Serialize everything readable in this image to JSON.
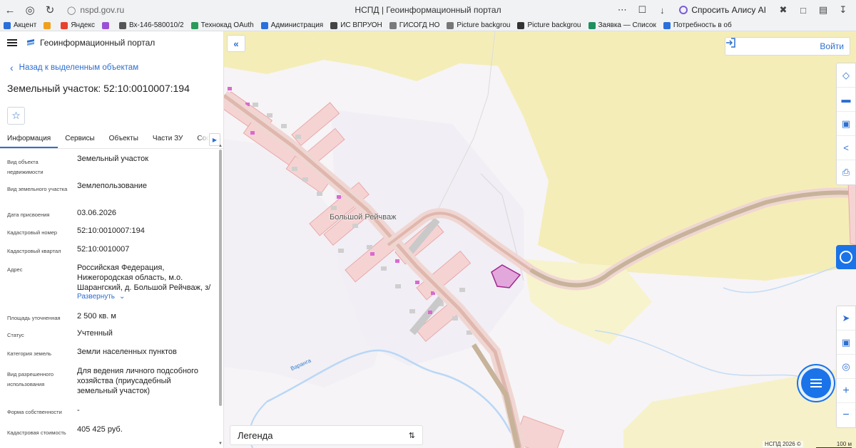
{
  "browser": {
    "url": "nspd.gov.ru",
    "tab_title": "НСПД | Геоинформационный портал",
    "ask_alice": "Спросить Алису AI",
    "bookmarks": [
      {
        "label": "Акцент",
        "color": "#2a6fdb"
      },
      {
        "label": "",
        "color": "#f0a020"
      },
      {
        "label": "Яндекс",
        "color": "#e8412c"
      },
      {
        "label": "",
        "color": "#9b4fd6"
      },
      {
        "label": "Вх-146-580010/2",
        "color": "#555555"
      },
      {
        "label": "Технокад OAuth",
        "color": "#2c9a5a"
      },
      {
        "label": "Администрация",
        "color": "#2a6fdb"
      },
      {
        "label": "ИС ВПРУОН",
        "color": "#444444"
      },
      {
        "label": "ГИСОГД НО",
        "color": "#7a7a7a"
      },
      {
        "label": "Picture backgrou",
        "color": "#777777"
      },
      {
        "label": "Picture backgrou",
        "color": "#333333"
      },
      {
        "label": "Заявка — Список",
        "color": "#1f8f5f"
      },
      {
        "label": "Потребность в об",
        "color": "#2a6fdb"
      }
    ]
  },
  "panel": {
    "portal_title": "Геоинформационный портал",
    "back_label": "Назад к выделенным объектам",
    "object_title": "Земельный участок: 52:10:0010007:194",
    "tabs": [
      "Информация",
      "Сервисы",
      "Объекты",
      "Части ЗУ",
      "Состав"
    ],
    "active_tab": "Информация",
    "expand_label": "Развернуть",
    "properties": [
      {
        "key": "Вид объекта недвижимости",
        "value": "Земельный участок"
      },
      {
        "key": "Вид земельного участка",
        "value": "Землепользование"
      },
      {
        "key": "Дата присвоения",
        "value": "03.06.2026"
      },
      {
        "key": "Кадастровый номер",
        "value": "52:10:0010007:194"
      },
      {
        "key": "Кадастровый квартал",
        "value": "52:10:0010007"
      },
      {
        "key": "Адрес",
        "value": "Российская Федерация, Нижегородская область, м.о. Шарангский, д. Большой Рейчваж, з/"
      },
      {
        "key": "Площадь уточненная",
        "value": "2 500 кв. м"
      },
      {
        "key": "Статус",
        "value": "Учтенный"
      },
      {
        "key": "Категория земель",
        "value": "Земли населенных пунктов"
      },
      {
        "key": "Вид разрешенного использования",
        "value": "Для ведения личного подсобного хозяйства (приусадебный земельный участок)"
      },
      {
        "key": "Форма собственности",
        "value": "-"
      },
      {
        "key": "Кадастровая стоимость",
        "value": "405 425 руб."
      }
    ]
  },
  "map": {
    "login_label": "Войти",
    "place_name": "Большой Рейчваж",
    "river_name": "Варанга",
    "legend_label": "Легенда",
    "attribution": "НСПД 2026 ©",
    "scale_label": "100 м",
    "tools_top": [
      "layers-icon",
      "ruler-icon",
      "select-area-icon",
      "share-icon",
      "print-icon"
    ],
    "tools_bottom": [
      "locate-icon",
      "minimap-icon",
      "gps-icon",
      "zoom-in-icon",
      "zoom-out-icon"
    ],
    "colors": {
      "field": "#f4edb8",
      "settlement": "#f3eff6",
      "road": "#c7b39a",
      "parcel_fill": "#f6d3d3",
      "parcel_stroke": "#e7a9a9",
      "selected_parcel": "#e2a8dc",
      "selected_stroke": "#a1278f",
      "river": "#b9d7f7",
      "accent": "#2d6fd0"
    }
  }
}
